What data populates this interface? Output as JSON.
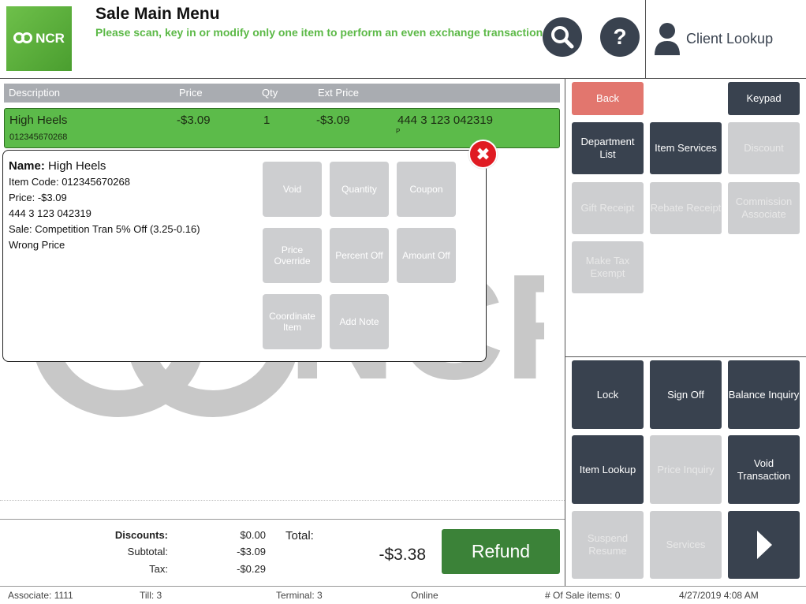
{
  "header": {
    "logo_text": "NCR",
    "title": "Sale Main Menu",
    "subtitle": "Please scan, key in or modify only one item to perform an even exchange transaction.",
    "search_icon": "magnifier-icon",
    "help_label": "?",
    "client_lookup_label": "Client Lookup"
  },
  "table": {
    "columns": [
      "Description",
      "Price",
      "Qty",
      "Ext Price"
    ],
    "rows": [
      {
        "description": "High Heels",
        "code": "012345670268",
        "price": "-$3.09",
        "qty": "1",
        "ext_price": "-$3.09",
        "upc": "444 3 123 042319",
        "flag": "P"
      }
    ]
  },
  "detail": {
    "name_label": "Name:",
    "name": "High Heels",
    "item_code": "Item Code: 012345670268",
    "price": "Price: -$3.09",
    "upc": "444 3 123 042319",
    "sale": "Sale: Competition Tran 5% Off (3.25-0.16)",
    "reason": "Wrong Price",
    "close_label": "✖",
    "buttons": {
      "void": "Void",
      "quantity": "Quantity",
      "coupon": "Coupon",
      "price_override": "Price Override",
      "percent_off": "Percent Off",
      "amount_off": "Amount Off",
      "coordinate_item": "Coordinate Item",
      "add_note": "Add Note"
    }
  },
  "totals": {
    "discounts_label": "Discounts:",
    "discounts": "$0.00",
    "subtotal_label": "Subtotal:",
    "subtotal": "-$3.09",
    "tax_label": "Tax:",
    "tax": "-$0.29",
    "total_label": "Total:",
    "total": "-$3.38",
    "refund_label": "Refund"
  },
  "actions": {
    "back": "Back",
    "keypad": "Keypad",
    "department_list": "Department List",
    "item_services": "Item Services",
    "discount": "Discount",
    "gift_receipt": "Gift Receipt",
    "rebate_receipt": "Rebate Receipt",
    "commission_associate": "Commission Associate",
    "make_tax_exempt": "Make Tax Exempt",
    "lock": "Lock",
    "sign_off": "Sign Off",
    "balance_inquiry": "Balance Inquiry",
    "item_lookup": "Item Lookup",
    "price_inquiry": "Price Inquiry",
    "void_transaction": "Void Transaction",
    "suspend_resume": "Suspend Resume",
    "services": "Services",
    "next_icon": "right-arrow-icon"
  },
  "status": {
    "associate": "Associate: 1111",
    "till": "Till: 3",
    "terminal": "Terminal: 3",
    "connection": "Online",
    "sale_items": "# Of Sale items: 0",
    "datetime": "4/27/2019 4:08 AM"
  },
  "colors": {
    "brand_green": "#5cbb4a",
    "dark_button": "#39424f",
    "disabled_button": "#cdced0",
    "back_button": "#e2766e",
    "refund_button": "#3b8238",
    "close_button": "#e01b22"
  }
}
